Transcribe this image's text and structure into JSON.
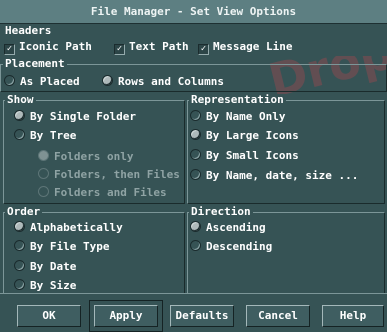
{
  "window": {
    "title": "File Manager - Set View Options"
  },
  "watermark": "Drop",
  "headers": {
    "title": "Headers",
    "items": [
      {
        "label": "Iconic Path",
        "checked": true
      },
      {
        "label": "Text Path",
        "checked": true
      },
      {
        "label": "Message Line",
        "checked": true
      }
    ]
  },
  "placement": {
    "title": "Placement",
    "items": [
      {
        "label": "As Placed",
        "selected": false
      },
      {
        "label": "Rows and Columns",
        "selected": true
      }
    ]
  },
  "show": {
    "title": "Show",
    "items": [
      {
        "label": "By Single Folder",
        "selected": true
      },
      {
        "label": "By Tree",
        "selected": false
      },
      {
        "label": "Folders only",
        "selected": true,
        "disabled": true
      },
      {
        "label": "Folders, then Files",
        "selected": false,
        "disabled": true
      },
      {
        "label": "Folders and Files",
        "selected": false,
        "disabled": true
      }
    ]
  },
  "representation": {
    "title": "Representation",
    "items": [
      {
        "label": "By Name Only",
        "selected": false
      },
      {
        "label": "By Large Icons",
        "selected": true
      },
      {
        "label": "By Small Icons",
        "selected": false
      },
      {
        "label": "By Name, date, size ...",
        "selected": false
      }
    ]
  },
  "order": {
    "title": "Order",
    "items": [
      {
        "label": "Alphabetically",
        "selected": true
      },
      {
        "label": "By File Type",
        "selected": false
      },
      {
        "label": "By Date",
        "selected": false
      },
      {
        "label": "By Size",
        "selected": false
      }
    ]
  },
  "direction": {
    "title": "Direction",
    "items": [
      {
        "label": "Ascending",
        "selected": true
      },
      {
        "label": "Descending",
        "selected": false
      }
    ]
  },
  "buttons": {
    "ok": "OK",
    "apply": "Apply",
    "defaults": "Defaults",
    "cancel": "Cancel",
    "help": "Help"
  }
}
